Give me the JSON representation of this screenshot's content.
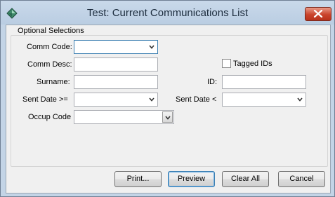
{
  "window": {
    "title": "Test: Current Communications List"
  },
  "group": {
    "label": "Optional Selections"
  },
  "fields": {
    "comm_code_label": "Comm Code:",
    "comm_desc_label": "Comm Desc:",
    "surname_label": "Surname:",
    "sent_date_ge_label": "Sent Date >=",
    "occup_code_label": "Occup Code",
    "tagged_ids_label": "Tagged IDs",
    "id_label": "ID:",
    "sent_date_lt_label": "Sent Date <"
  },
  "buttons": {
    "print": "Print...",
    "preview": "Preview",
    "clear_all": "Clear All",
    "cancel": "Cancel"
  },
  "colors": {
    "titlebar": "#c3d4e6",
    "close": "#c9442c",
    "accent_focus": "#3c7fb1"
  }
}
